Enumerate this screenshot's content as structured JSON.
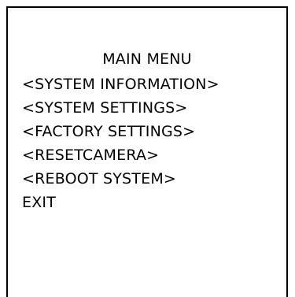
{
  "menu": {
    "title": "MAIN MENU",
    "items": [
      {
        "label": "<SYSTEM INFORMATION>"
      },
      {
        "label": "<SYSTEM SETTINGS>"
      },
      {
        "label": "<FACTORY SETTINGS>"
      },
      {
        "label": "<RESETCAMERA>"
      },
      {
        "label": "<REBOOT SYSTEM>"
      },
      {
        "label": "EXIT"
      }
    ]
  }
}
